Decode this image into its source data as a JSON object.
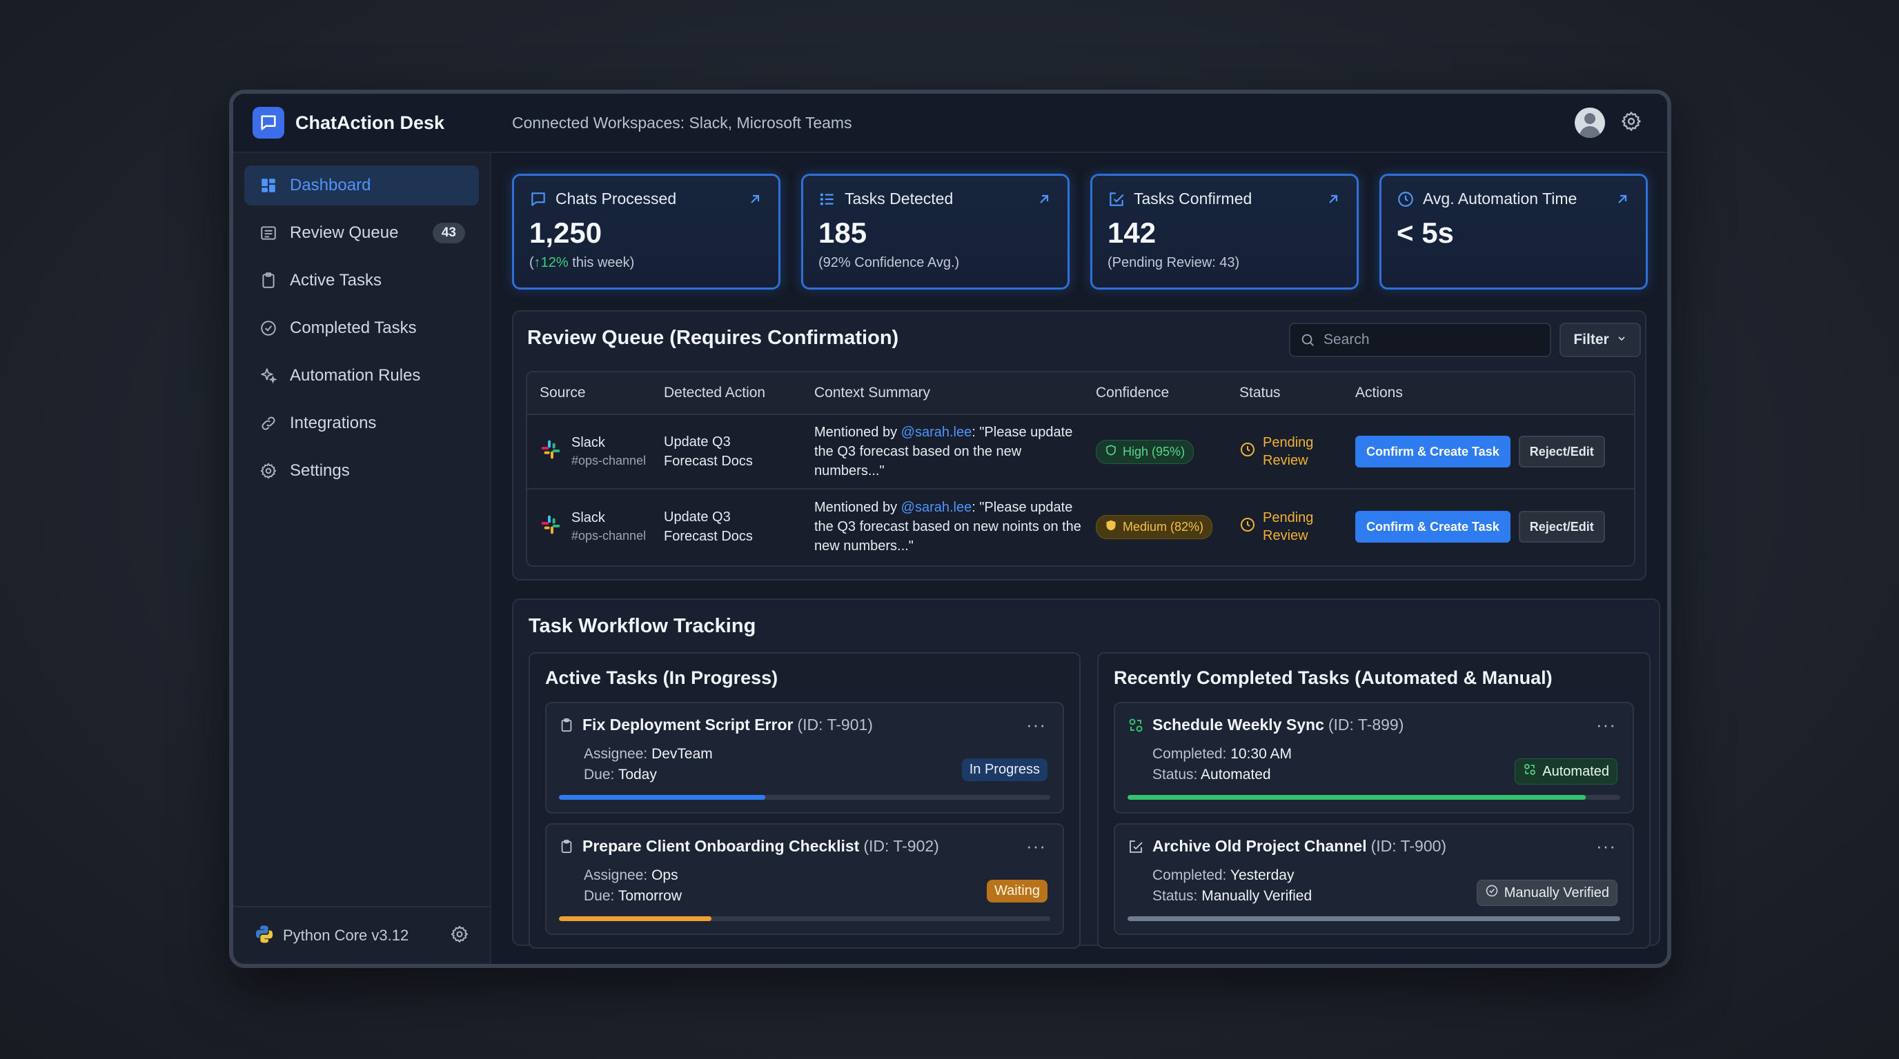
{
  "app": {
    "title": "ChatAction Desk",
    "workspaces": "Connected Workspaces: Slack, Microsoft Teams"
  },
  "sidebar": {
    "items": [
      {
        "label": "Dashboard",
        "icon": "dashboard-icon",
        "active": true
      },
      {
        "label": "Review Queue",
        "icon": "review-queue-icon",
        "badge": "43"
      },
      {
        "label": "Active Tasks",
        "icon": "clipboard-icon"
      },
      {
        "label": "Completed Tasks",
        "icon": "check-circle-icon"
      },
      {
        "label": "Automation Rules",
        "icon": "sparkle-icon"
      },
      {
        "label": "Integrations",
        "icon": "link-icon"
      },
      {
        "label": "Settings",
        "icon": "gear-icon"
      }
    ],
    "footer": {
      "version": "Python Core v3.12"
    }
  },
  "stats": [
    {
      "label": "Chats Processed",
      "value": "1,250",
      "sub_trend": "↑12%",
      "sub_rest": " this week",
      "icon": "chat-icon"
    },
    {
      "label": "Tasks Detected",
      "value": "185",
      "sub": "(92% Confidence Avg.)",
      "icon": "list-icon"
    },
    {
      "label": "Tasks Confirmed",
      "value": "142",
      "sub": "(Pending Review: 43)",
      "icon": "edit-check-icon"
    },
    {
      "label": "Avg. Automation Time",
      "value": "< 5s",
      "icon": "clock-icon"
    }
  ],
  "review": {
    "title": "Review Queue (Requires Confirmation)",
    "search_placeholder": "Search",
    "filter_label": "Filter",
    "columns": [
      "Source",
      "Detected Action",
      "Context Summary",
      "Confidence",
      "Status",
      "Actions"
    ],
    "rows": [
      {
        "source": "Slack",
        "channel": "#ops-channel",
        "action_line1": "Update Q3",
        "action_line2": "Forecast Docs",
        "context_pre": "Mentioned by ",
        "mention": "@sarah.lee",
        "context_post": ": \"Please update the Q3 forecast based on the new numbers...\"",
        "confidence": "High (95%)",
        "confidence_level": "high",
        "status_line1": "Pending",
        "status_line2": "Review",
        "confirm_label": "Confirm & Create Task",
        "reject_label": "Reject/Edit"
      },
      {
        "source": "Slack",
        "channel": "#ops-channel",
        "action_line1": "Update Q3",
        "action_line2": "Forecast Docs",
        "context_pre": "Mentioned by ",
        "mention": "@sarah.lee",
        "context_post": ": \"Please update the Q3 forecast based on new noints on the new numbers...\"",
        "confidence": "Medium (82%)",
        "confidence_level": "medium",
        "status_line1": "Pending",
        "status_line2": "Review",
        "confirm_label": "Confirm & Create Task",
        "reject_label": "Reject/Edit"
      }
    ]
  },
  "workflow": {
    "title": "Task Workflow Tracking",
    "active": {
      "title": "Active Tasks (In Progress)",
      "tasks": [
        {
          "name": "Fix Deployment Script Error",
          "id": "(ID: T-901)",
          "assignee_label": "Assignee: ",
          "assignee": "DevTeam",
          "due_label": "Due: ",
          "due": "Today",
          "badge": "In Progress",
          "progress": 0.42,
          "color": "#2f7cf0"
        },
        {
          "name": "Prepare Client Onboarding Checklist",
          "id": "(ID: T-902)",
          "assignee_label": "Assignee: ",
          "assignee": "Ops",
          "due_label": "Due: ",
          "due": "Tomorrow",
          "badge": "Waiting",
          "progress": 0.31,
          "color": "#f0a030"
        }
      ]
    },
    "completed": {
      "title": "Recently Completed Tasks (Automated & Manual)",
      "tasks": [
        {
          "name": "Schedule Weekly Sync",
          "id": "(ID: T-899)",
          "completed_label": "Completed: ",
          "completed": "10:30 AM",
          "status_label": "Status: ",
          "status": "Automated",
          "badge": "Automated",
          "progress": 0.93,
          "color": "#34c26f"
        },
        {
          "name": "Archive Old Project Channel",
          "id": "(ID: T-900)",
          "completed_label": "Completed: ",
          "completed": "Yesterday",
          "status_label": "Status: ",
          "status": "Manually Verified",
          "badge": "Manually Verified",
          "progress": 1.0,
          "color": "#6f7b8e"
        }
      ]
    }
  }
}
